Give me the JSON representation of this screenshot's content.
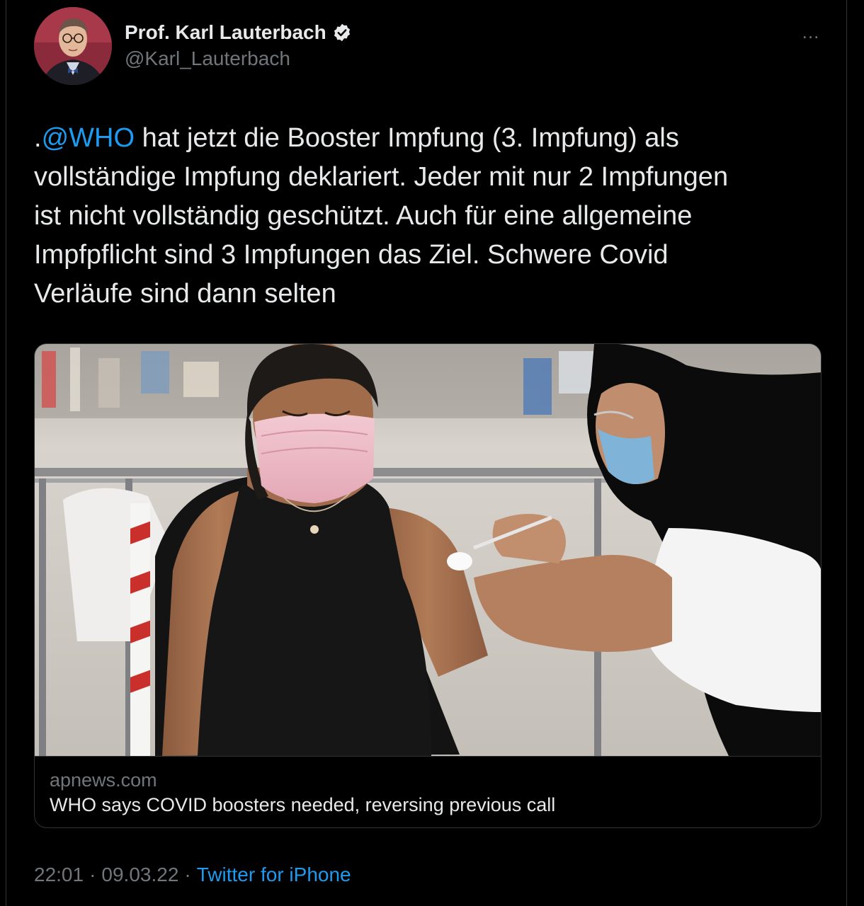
{
  "author": {
    "display_name": "Prof. Karl Lauterbach",
    "handle": "@Karl_Lauterbach",
    "verified": true
  },
  "more_icon": "…",
  "tweet": {
    "prefix": ".",
    "mention": "@WHO",
    "body": " hat jetzt die Booster Impfung (3. Impfung) als\nvollständige Impfung deklariert. Jeder mit nur 2 Impfungen\nist nicht vollständig geschützt. Auch für eine allgemeine\nImpfpflicht sind 3 Impfungen das Ziel. Schwere Covid\nVerläufe sind dann selten"
  },
  "link_card": {
    "domain": "apnews.com",
    "title": "WHO says COVID boosters needed, reversing previous call"
  },
  "footer": {
    "time": "22:01",
    "separator1": "·",
    "date": "09.03.22",
    "separator2": "·",
    "source": "Twitter for iPhone"
  },
  "colors": {
    "background": "#000000",
    "text": "#e7e9ea",
    "secondary": "#71767b",
    "accent": "#1d9bf0",
    "border": "#2f3336"
  }
}
